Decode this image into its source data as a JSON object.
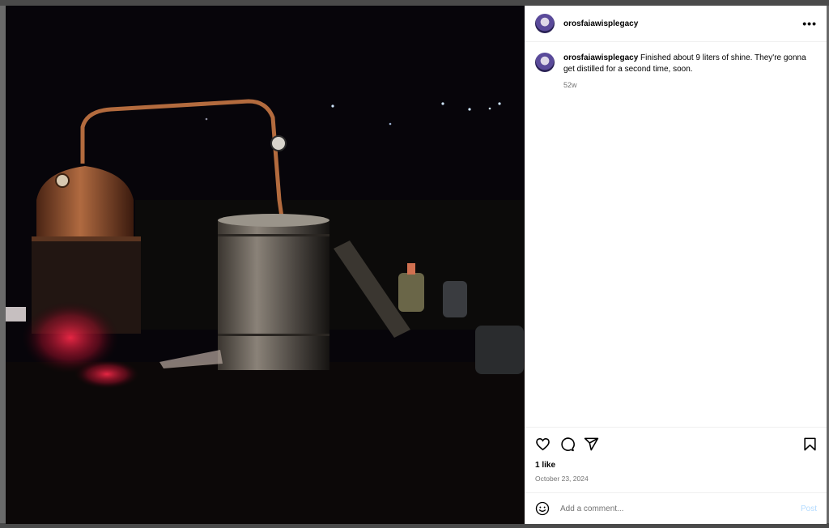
{
  "post": {
    "username": "orosfaiawisplegacy",
    "more_icon": "more-horizontal-icon",
    "caption": {
      "username": "orosfaiawisplegacy",
      "text": "Finished about 9 liters of shine. They're gonna get distilled for a second time, soon.",
      "age": "52w"
    },
    "likes": "1 like",
    "date": "October 23, 2024"
  },
  "actions": {
    "icons": [
      "heart-icon",
      "comment-icon",
      "share-icon",
      "bookmark-icon"
    ]
  },
  "comment_box": {
    "placeholder": "Add a comment...",
    "post_label": "Post",
    "emoji_icon": "emoji-icon"
  },
  "colors": {
    "photo_background": "#07050a",
    "copper": "#a0603a",
    "post_button_disabled": "#b3dbff",
    "secondary_text": "#737373"
  }
}
